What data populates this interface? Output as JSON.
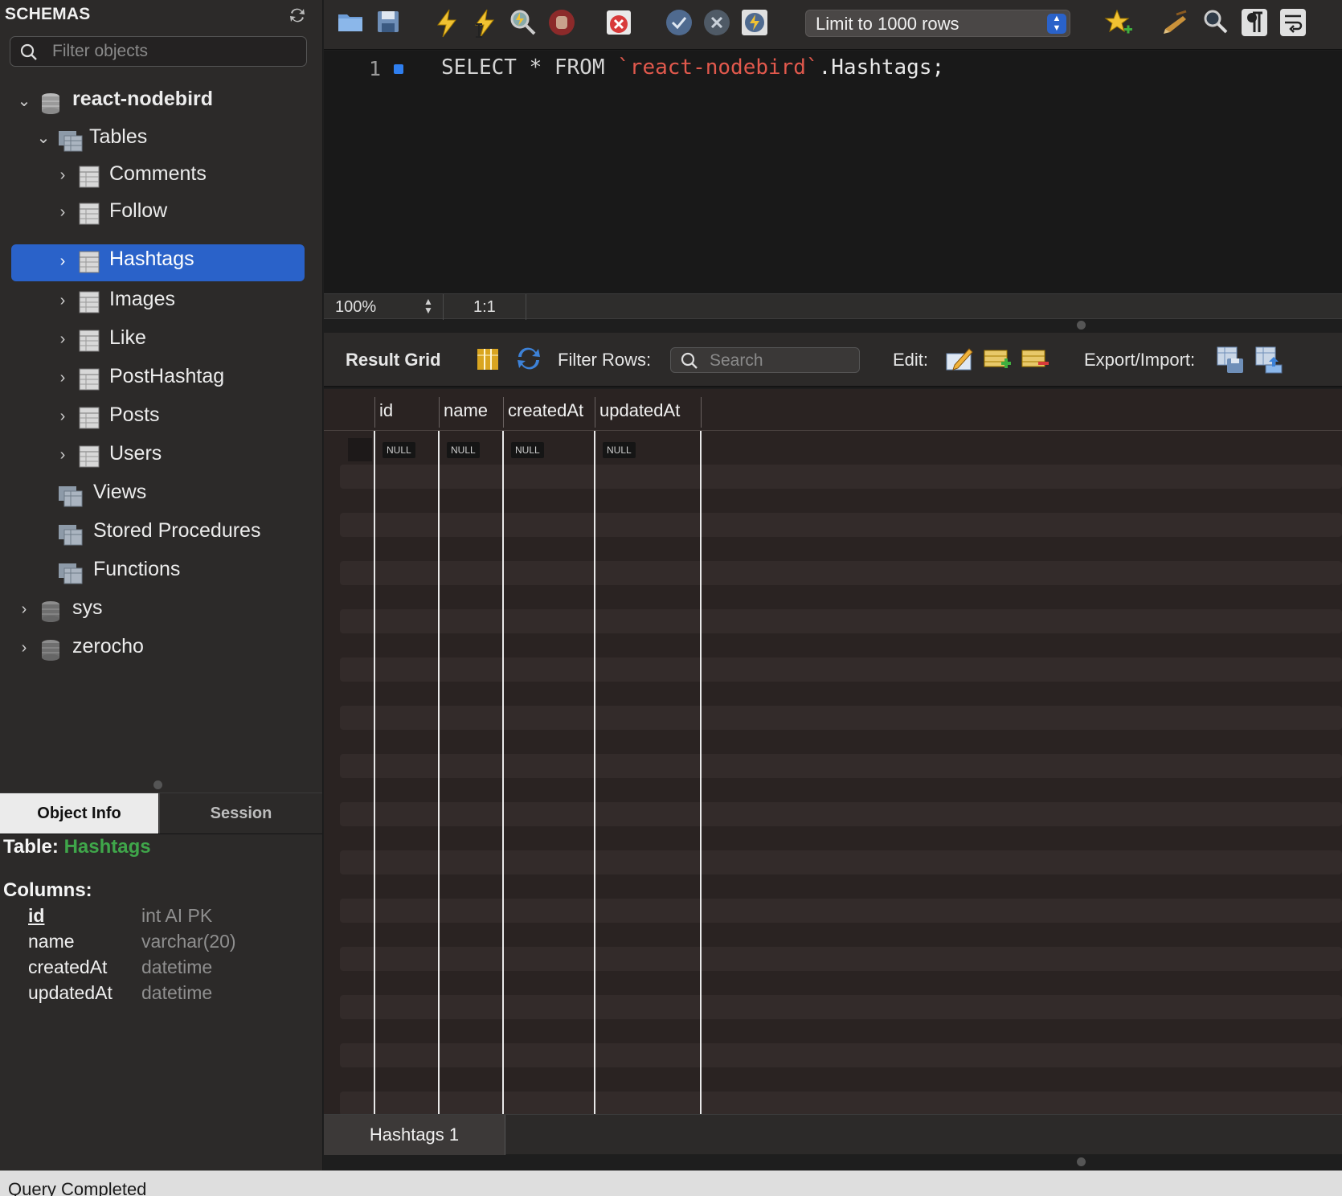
{
  "sidebar": {
    "title": "SCHEMAS",
    "filter_placeholder": "Filter objects",
    "schema_open": "react-nodebird",
    "tables_label": "Tables",
    "tables": [
      "Comments",
      "Follow",
      "Hashtags",
      "Images",
      "Like",
      "PostHashtag",
      "Posts",
      "Users"
    ],
    "selected_table": "Hashtags",
    "views_label": "Views",
    "procedures_label": "Stored Procedures",
    "functions_label": "Functions",
    "other_schemas": [
      "sys",
      "zerocho"
    ]
  },
  "info_tabs": {
    "object_info": "Object Info",
    "session": "Session"
  },
  "object_info": {
    "table_prefix": "Table:",
    "table_name": "Hashtags",
    "columns_label": "Columns:",
    "columns": [
      {
        "name": "id",
        "type": "int AI PK"
      },
      {
        "name": "name",
        "type": "varchar(20)"
      },
      {
        "name": "createdAt",
        "type": "datetime"
      },
      {
        "name": "updatedAt",
        "type": "datetime"
      }
    ]
  },
  "toolbar": {
    "limit_label": "Limit to 1000 rows"
  },
  "editor": {
    "line_number": "1",
    "sql_select": "SELECT * FROM ",
    "sql_table_schema": "`react-nodebird`",
    "sql_rest": ".Hashtags;",
    "zoom": "100%",
    "cursor_position": "1:1"
  },
  "result_toolbar": {
    "result_grid_label": "Result Grid",
    "filter_rows_label": "Filter Rows:",
    "search_placeholder": "Search",
    "edit_label": "Edit:",
    "export_label": "Export/Import:"
  },
  "grid": {
    "columns": [
      "id",
      "name",
      "createdAt",
      "updatedAt"
    ],
    "rows": [
      [
        "NULL",
        "NULL",
        "NULL",
        "NULL"
      ]
    ]
  },
  "result_tabs": [
    "Hashtags 1"
  ],
  "status": "Query Completed",
  "colors": {
    "selection": "#2a62c9",
    "table_name_green": "#3fa64a",
    "sql_string_red": "#e2594d"
  }
}
